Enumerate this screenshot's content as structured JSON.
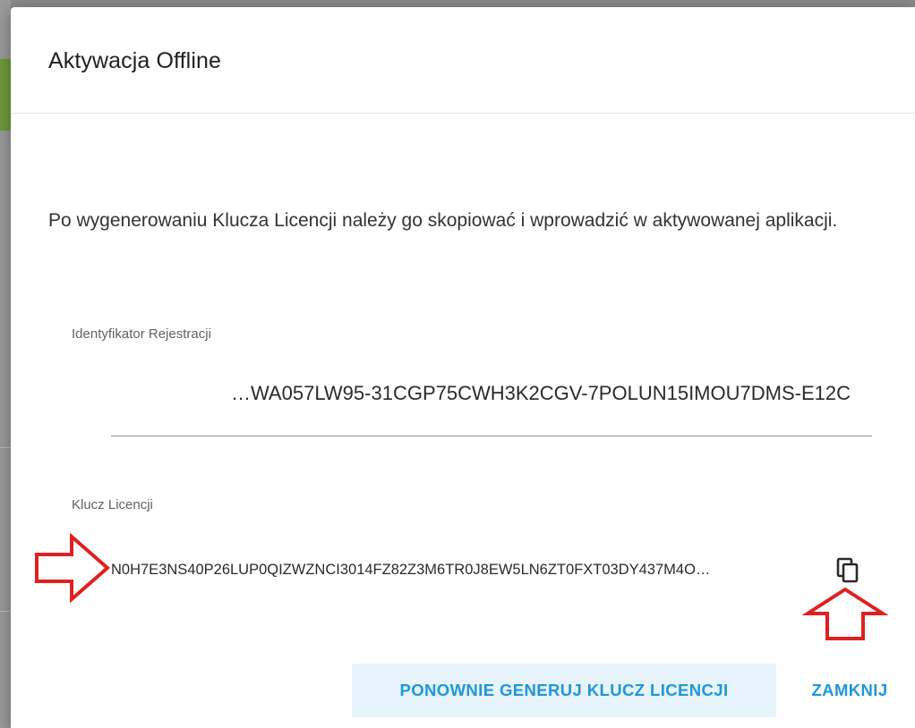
{
  "dialog": {
    "title": "Aktywacja Offline",
    "message": "Po wygenerowaniu Klucza Licencji należy go skopiować i wprowadzić w aktywowanej aplikacji."
  },
  "registration": {
    "label": "Identyfikator Rejestracji",
    "value": "…WA057LW95-31CGP75CWH3K2CGV-7POLUN15IMOU7DMS-E12C"
  },
  "license_key": {
    "label": "Klucz Licencji",
    "value": "N0H7E3NS40P26LUP0QIZWZNCI3014FZ82Z3M6TR0J8EW5LN6ZT0FXT03DY437M4O…",
    "copy_icon": "copy-icon"
  },
  "annotations": {
    "arrow_color": "#e02020"
  },
  "buttons": {
    "regenerate_label": "PONOWNIE GENERUJ KLUCZ LICENCJI",
    "close_label": "ZAMKNIJ"
  },
  "colors": {
    "accent": "#2196d8",
    "regen_bg": "#e6f3fb",
    "backdrop": "#7a7a7a"
  }
}
